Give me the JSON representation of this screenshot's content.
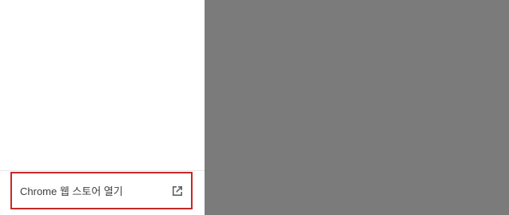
{
  "sidebar": {
    "footer_link": {
      "label": "Chrome 웹 스토어 열기",
      "icon": "open-in-new-icon"
    }
  },
  "colors": {
    "content_background": "#7b7b7c",
    "highlight_border": "#c62828",
    "icon_color": "#5f6368"
  }
}
